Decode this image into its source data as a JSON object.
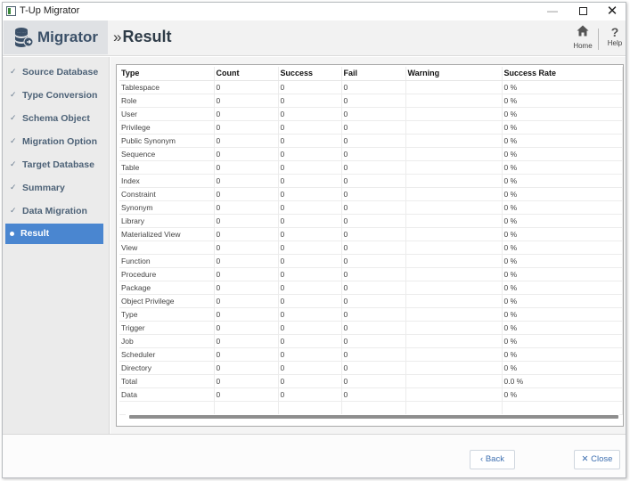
{
  "window": {
    "title": "T-Up Migrator"
  },
  "header": {
    "brand": "Migrator",
    "page_title": "Result",
    "page_title_prefix": "»",
    "home_label": "Home",
    "help_label": "Help"
  },
  "sidebar": {
    "items": [
      {
        "label": "Source Database",
        "state": "done"
      },
      {
        "label": "Type Conversion",
        "state": "done"
      },
      {
        "label": "Schema Object",
        "state": "done"
      },
      {
        "label": "Migration Option",
        "state": "done"
      },
      {
        "label": "Target Database",
        "state": "done"
      },
      {
        "label": "Summary",
        "state": "done"
      },
      {
        "label": "Data Migration",
        "state": "done"
      },
      {
        "label": "Result",
        "state": "active"
      }
    ]
  },
  "result_table": {
    "columns": [
      "Type",
      "Count",
      "Success",
      "Fail",
      "Warning",
      "Success Rate"
    ],
    "rows": [
      [
        "Tablespace",
        "0",
        "0",
        "0",
        "",
        "0 %"
      ],
      [
        "Role",
        "0",
        "0",
        "0",
        "",
        "0 %"
      ],
      [
        "User",
        "0",
        "0",
        "0",
        "",
        "0 %"
      ],
      [
        "Privilege",
        "0",
        "0",
        "0",
        "",
        "0 %"
      ],
      [
        "Public Synonym",
        "0",
        "0",
        "0",
        "",
        "0 %"
      ],
      [
        "Sequence",
        "0",
        "0",
        "0",
        "",
        "0 %"
      ],
      [
        "Table",
        "0",
        "0",
        "0",
        "",
        "0 %"
      ],
      [
        "Index",
        "0",
        "0",
        "0",
        "",
        "0 %"
      ],
      [
        "Constraint",
        "0",
        "0",
        "0",
        "",
        "0 %"
      ],
      [
        "Synonym",
        "0",
        "0",
        "0",
        "",
        "0 %"
      ],
      [
        "Library",
        "0",
        "0",
        "0",
        "",
        "0 %"
      ],
      [
        "Materialized View",
        "0",
        "0",
        "0",
        "",
        "0 %"
      ],
      [
        "View",
        "0",
        "0",
        "0",
        "",
        "0 %"
      ],
      [
        "Function",
        "0",
        "0",
        "0",
        "",
        "0 %"
      ],
      [
        "Procedure",
        "0",
        "0",
        "0",
        "",
        "0 %"
      ],
      [
        "Package",
        "0",
        "0",
        "0",
        "",
        "0 %"
      ],
      [
        "Object Privilege",
        "0",
        "0",
        "0",
        "",
        "0 %"
      ],
      [
        "Type",
        "0",
        "0",
        "0",
        "",
        "0 %"
      ],
      [
        "Trigger",
        "0",
        "0",
        "0",
        "",
        "0 %"
      ],
      [
        "Job",
        "0",
        "0",
        "0",
        "",
        "0 %"
      ],
      [
        "Scheduler",
        "0",
        "0",
        "0",
        "",
        "0 %"
      ],
      [
        "Directory",
        "0",
        "0",
        "0",
        "",
        "0 %"
      ],
      [
        "Total",
        "0",
        "0",
        "0",
        "",
        "0.0 %"
      ],
      [
        "Data",
        "0",
        "0",
        "0",
        "",
        "0 %"
      ]
    ]
  },
  "footer": {
    "back_label": "Back",
    "back_icon": "‹",
    "close_label": "Close",
    "close_icon": "✕"
  },
  "colors": {
    "accent": "#4a86d0",
    "brand_text": "#3b5068",
    "nav_text": "#4d6277",
    "button_text": "#3d6fb0"
  },
  "icons": {
    "app": "app-icon",
    "brand": "database-migrate-icon",
    "home": "home-icon",
    "help": "question-icon",
    "nav_done": "check-icon",
    "nav_active": "dot-icon"
  }
}
